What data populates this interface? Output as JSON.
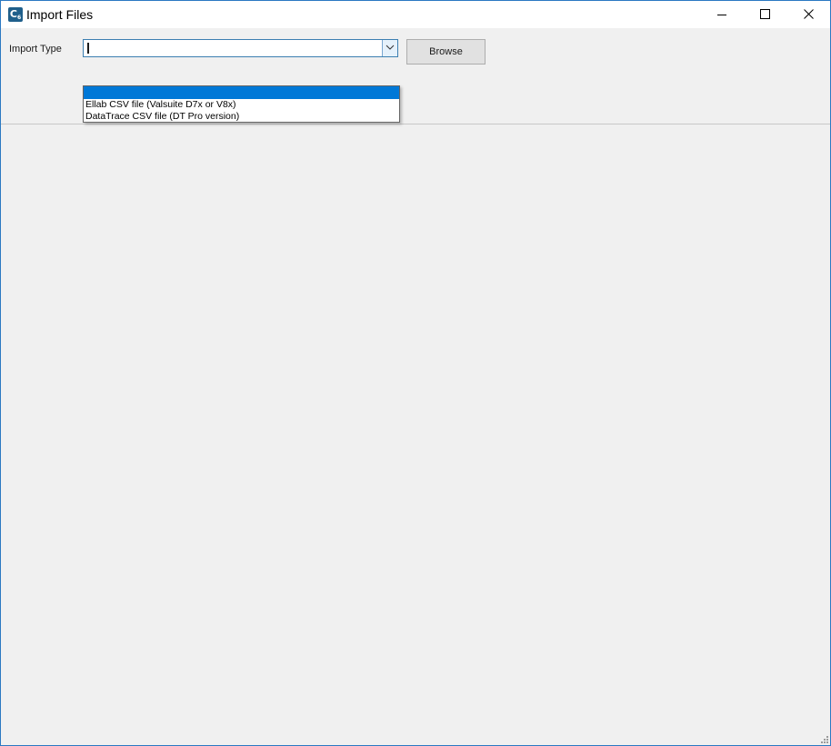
{
  "window": {
    "title": "Import Files",
    "icon": "c6-app-icon",
    "icon_letter": "C",
    "icon_sub": "6"
  },
  "import": {
    "label": "Import Type",
    "combo_value": "",
    "browse_label": "Browse",
    "options": [
      "",
      "Ellab CSV file (Valsuite D7x or V8x)",
      "DataTrace CSV file (DT Pro version)"
    ],
    "selected_index": 0
  },
  "colors": {
    "accent": "#0078d7",
    "window_border": "#2b79c2",
    "background": "#f0f0f0"
  }
}
